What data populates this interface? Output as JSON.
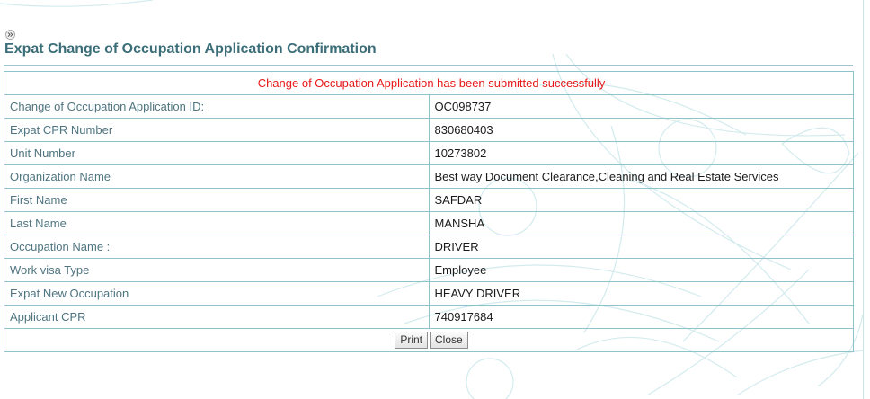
{
  "page": {
    "title": "Expat Change of Occupation Application Confirmation",
    "expand_icon": "double-chevron-right-icon"
  },
  "confirmation": {
    "message": "Change of Occupation Application has been submitted successfully",
    "message_color": "#e81818",
    "rows": [
      {
        "label": "Change of Occupation Application ID:",
        "value": "OC098737"
      },
      {
        "label": "Expat CPR Number",
        "value": "830680403"
      },
      {
        "label": "Unit Number",
        "value": "10273802"
      },
      {
        "label": "Organization Name",
        "value": "Best way Document Clearance,Cleaning and Real Estate Services"
      },
      {
        "label": "First Name",
        "value": "SAFDAR"
      },
      {
        "label": "Last Name",
        "value": "MANSHA"
      },
      {
        "label": "Occupation Name :",
        "value": "DRIVER"
      },
      {
        "label": "Work visa Type",
        "value": "Employee"
      },
      {
        "label": "Expat New Occupation",
        "value": "HEAVY DRIVER"
      },
      {
        "label": "Applicant CPR",
        "value": "740917684"
      }
    ]
  },
  "actions": {
    "print_label": "Print",
    "close_label": "Close"
  },
  "colors": {
    "title": "#3b6e78",
    "label_text": "#4f7580",
    "table_border": "#8fc3cb"
  }
}
